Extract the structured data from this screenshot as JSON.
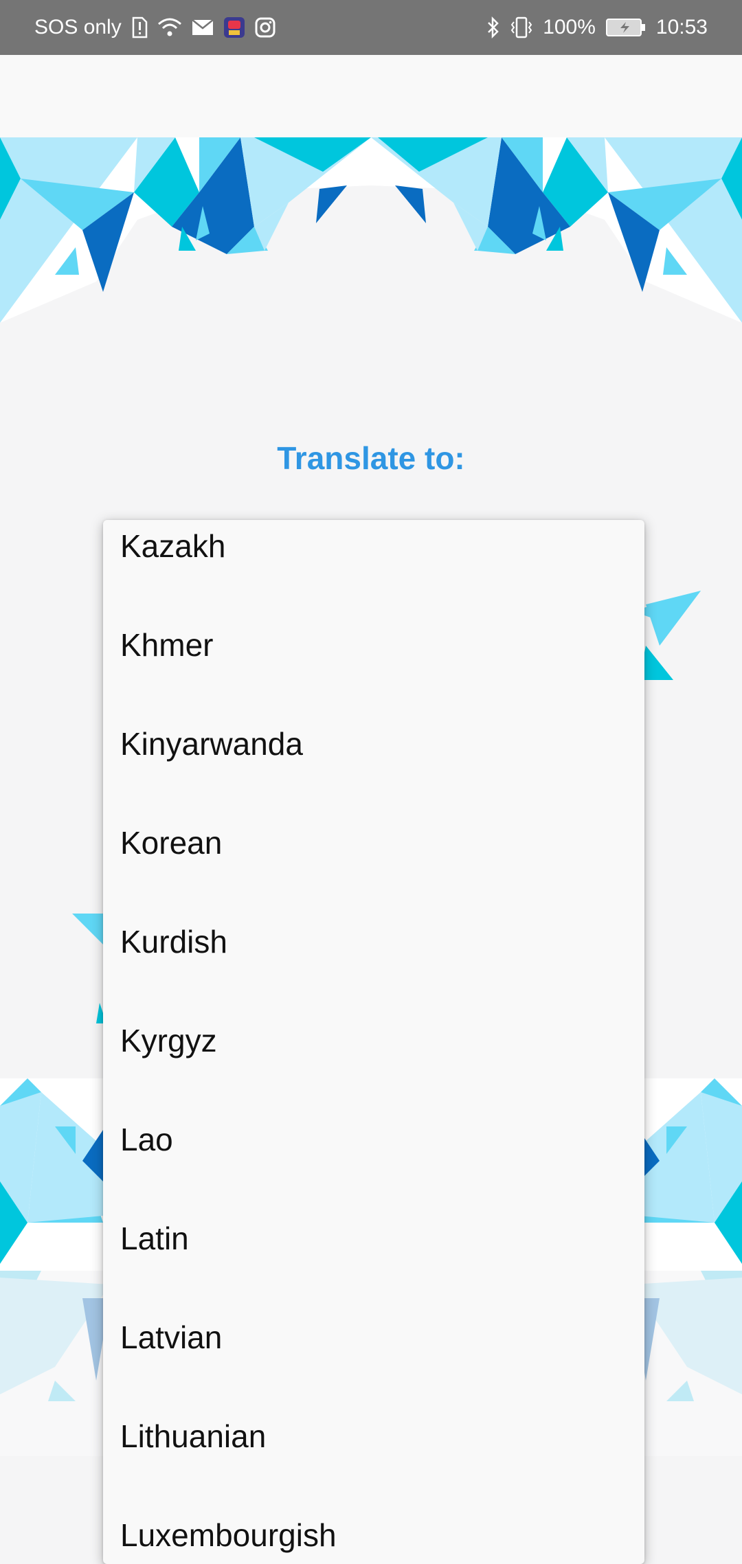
{
  "status_bar": {
    "carrier": "SOS only",
    "battery": "100%",
    "time": "10:53",
    "icons_left": [
      "sim-alert-icon",
      "wifi-icon",
      "mail-icon",
      "app-notification-icon",
      "instagram-icon"
    ],
    "icons_right": [
      "bluetooth-icon",
      "vibrate-icon",
      "battery-icon"
    ]
  },
  "page": {
    "title": "Translate to:"
  },
  "languages": [
    "Kazakh",
    "Khmer",
    "Kinyarwanda",
    "Korean",
    "Kurdish",
    "Kyrgyz",
    "Lao",
    "Latin",
    "Latvian",
    "Lithuanian",
    "Luxembourgish"
  ],
  "colors": {
    "accent": "#2f96e3",
    "status_bar_bg": "#757575",
    "decor_dark_blue": "#0a6cc1",
    "decor_cyan": "#00c6dd",
    "decor_light_blue": "#5fd7f5",
    "decor_pale_blue": "#b3e9fb"
  }
}
